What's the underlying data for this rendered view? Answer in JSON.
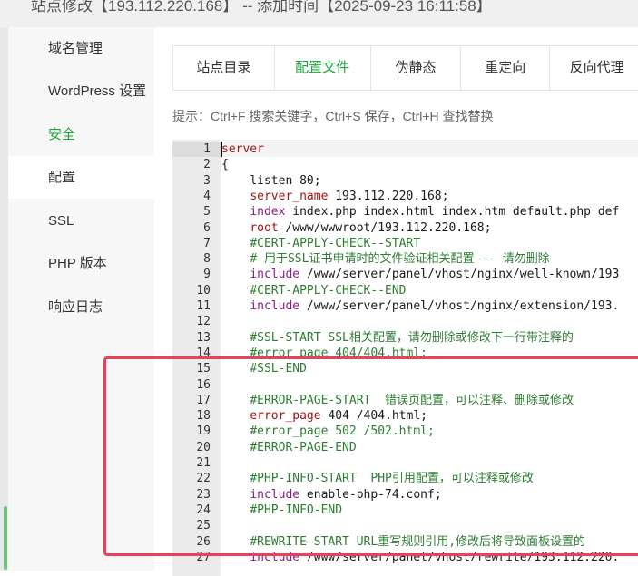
{
  "window": {
    "title": "站点修改【193.112.220.168】 -- 添加时间【2025-09-23 16:11:58】"
  },
  "sidebar": {
    "items": [
      {
        "label": "域名管理",
        "active": false
      },
      {
        "label": "WordPress 设置",
        "active": false
      },
      {
        "label": "安全",
        "active": false,
        "accent": true
      },
      {
        "label": "配置",
        "active": true
      },
      {
        "label": "SSL",
        "active": false
      },
      {
        "label": "PHP 版本",
        "active": false
      },
      {
        "label": "响应日志",
        "active": false
      }
    ]
  },
  "tabs": [
    {
      "label": "站点目录",
      "active": false
    },
    {
      "label": "配置文件",
      "active": true
    },
    {
      "label": "伪静态",
      "active": false
    },
    {
      "label": "重定向",
      "active": false
    },
    {
      "label": "反向代理",
      "active": false
    }
  ],
  "tip": "提示：Ctrl+F 搜索关键字，Ctrl+S 保存，Ctrl+H 查找替换",
  "editor": {
    "lines": [
      {
        "n": "1",
        "indent": "",
        "parts": [
          [
            "kw",
            "server"
          ]
        ]
      },
      {
        "n": "2",
        "indent": "",
        "parts": [
          [
            "plain",
            "{"
          ]
        ]
      },
      {
        "n": "3",
        "indent": "    ",
        "parts": [
          [
            "plain",
            "listen 80;"
          ]
        ]
      },
      {
        "n": "4",
        "indent": "    ",
        "parts": [
          [
            "kw",
            "server_name"
          ],
          [
            "plain",
            " 193.112.220.168;"
          ]
        ]
      },
      {
        "n": "5",
        "indent": "    ",
        "parts": [
          [
            "dir",
            "index"
          ],
          [
            "plain",
            " index.php index.html index.htm default.php def"
          ]
        ]
      },
      {
        "n": "6",
        "indent": "    ",
        "parts": [
          [
            "kw",
            "root"
          ],
          [
            "plain",
            " /www/wwwroot/193.112.220.168;"
          ]
        ]
      },
      {
        "n": "7",
        "indent": "    ",
        "parts": [
          [
            "cmt",
            "#CERT-APPLY-CHECK--START"
          ]
        ]
      },
      {
        "n": "8",
        "indent": "    ",
        "parts": [
          [
            "cmt",
            "# 用于SSL证书申请时的文件验证相关配置 -- 请勿删除"
          ]
        ]
      },
      {
        "n": "9",
        "indent": "    ",
        "parts": [
          [
            "dir",
            "include"
          ],
          [
            "plain",
            " /www/server/panel/vhost/nginx/well-known/193"
          ]
        ]
      },
      {
        "n": "10",
        "indent": "    ",
        "parts": [
          [
            "cmt",
            "#CERT-APPLY-CHECK--END"
          ]
        ]
      },
      {
        "n": "11",
        "indent": "    ",
        "parts": [
          [
            "dir",
            "include"
          ],
          [
            "plain",
            " /www/server/panel/vhost/nginx/extension/193."
          ]
        ]
      },
      {
        "n": "12",
        "indent": "",
        "parts": []
      },
      {
        "n": "13",
        "indent": "    ",
        "parts": [
          [
            "cmt",
            "#SSL-START SSL相关配置，请勿删除或修改下一行带注释的"
          ]
        ]
      },
      {
        "n": "14",
        "indent": "    ",
        "parts": [
          [
            "cmt",
            "#error_page 404/404.html;"
          ]
        ]
      },
      {
        "n": "15",
        "indent": "    ",
        "parts": [
          [
            "cmt",
            "#SSL-END"
          ]
        ]
      },
      {
        "n": "16",
        "indent": "",
        "parts": []
      },
      {
        "n": "17",
        "indent": "    ",
        "parts": [
          [
            "cmt",
            "#ERROR-PAGE-START  错误页配置，可以注释、删除或修改"
          ]
        ]
      },
      {
        "n": "18",
        "indent": "    ",
        "parts": [
          [
            "kw",
            "error_page"
          ],
          [
            "plain",
            " 404 /404.html;"
          ]
        ]
      },
      {
        "n": "19",
        "indent": "    ",
        "parts": [
          [
            "cmt",
            "#error_page 502 /502.html;"
          ]
        ]
      },
      {
        "n": "20",
        "indent": "    ",
        "parts": [
          [
            "cmt",
            "#ERROR-PAGE-END"
          ]
        ]
      },
      {
        "n": "21",
        "indent": "",
        "parts": []
      },
      {
        "n": "22",
        "indent": "    ",
        "parts": [
          [
            "cmt",
            "#PHP-INFO-START  PHP引用配置，可以注释或修改"
          ]
        ]
      },
      {
        "n": "23",
        "indent": "    ",
        "parts": [
          [
            "dir",
            "include"
          ],
          [
            "plain",
            " enable-php-74.conf;"
          ]
        ]
      },
      {
        "n": "24",
        "indent": "    ",
        "parts": [
          [
            "cmt",
            "#PHP-INFO-END"
          ]
        ]
      },
      {
        "n": "25",
        "indent": "",
        "parts": []
      },
      {
        "n": "26",
        "indent": "    ",
        "parts": [
          [
            "cmt",
            "#REWRITE-START URL重写规则引用,修改后将导致面板设置的"
          ]
        ]
      },
      {
        "n": "27",
        "indent": "    ",
        "parts": [
          [
            "dir",
            "include"
          ],
          [
            "plain",
            " /www/server/panel/vhost/rewrite/193.112.220."
          ]
        ]
      }
    ]
  },
  "colors": {
    "accent": "#20a53a",
    "highlight": "#e8425a",
    "keyword": "#a31515",
    "directive": "#8b1a8b",
    "comment": "#2e7d32"
  }
}
